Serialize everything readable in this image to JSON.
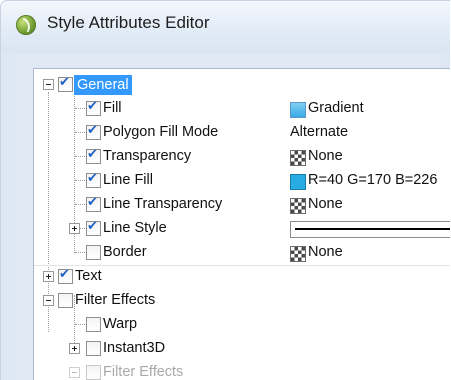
{
  "window": {
    "title": "Style Attributes Editor",
    "icon": "app-leaf-icon"
  },
  "tree": {
    "general": {
      "label": "General",
      "checked": true,
      "expanded": true
    },
    "properties": [
      {
        "label": "Fill",
        "checked": true,
        "value": "Gradient",
        "swatch": "gradient",
        "swatch_color": "#5ec0ef"
      },
      {
        "label": "Polygon Fill Mode",
        "checked": true,
        "value": "Alternate",
        "swatch": ""
      },
      {
        "label": "Transparency",
        "checked": true,
        "value": "None",
        "swatch": "none"
      },
      {
        "label": "Line Fill",
        "checked": true,
        "value": "R=40 G=170 B=226",
        "swatch": "solid",
        "swatch_color": "#28aae2"
      },
      {
        "label": "Line Transparency",
        "checked": true,
        "value": "None",
        "swatch": "none"
      },
      {
        "label": "Line Style",
        "checked": true,
        "value": "",
        "swatch": "line"
      },
      {
        "label": "Border",
        "checked": false,
        "value": "None",
        "swatch": "none"
      }
    ],
    "text": {
      "label": "Text",
      "checked": true
    },
    "filter_effects": {
      "label": "Filter Effects",
      "checked": false,
      "expanded": true
    },
    "filter_children": [
      {
        "label": "Warp",
        "checked": false
      },
      {
        "label": "Instant3D",
        "checked": false
      },
      {
        "label": "Filter Effects",
        "checked": false
      }
    ]
  }
}
